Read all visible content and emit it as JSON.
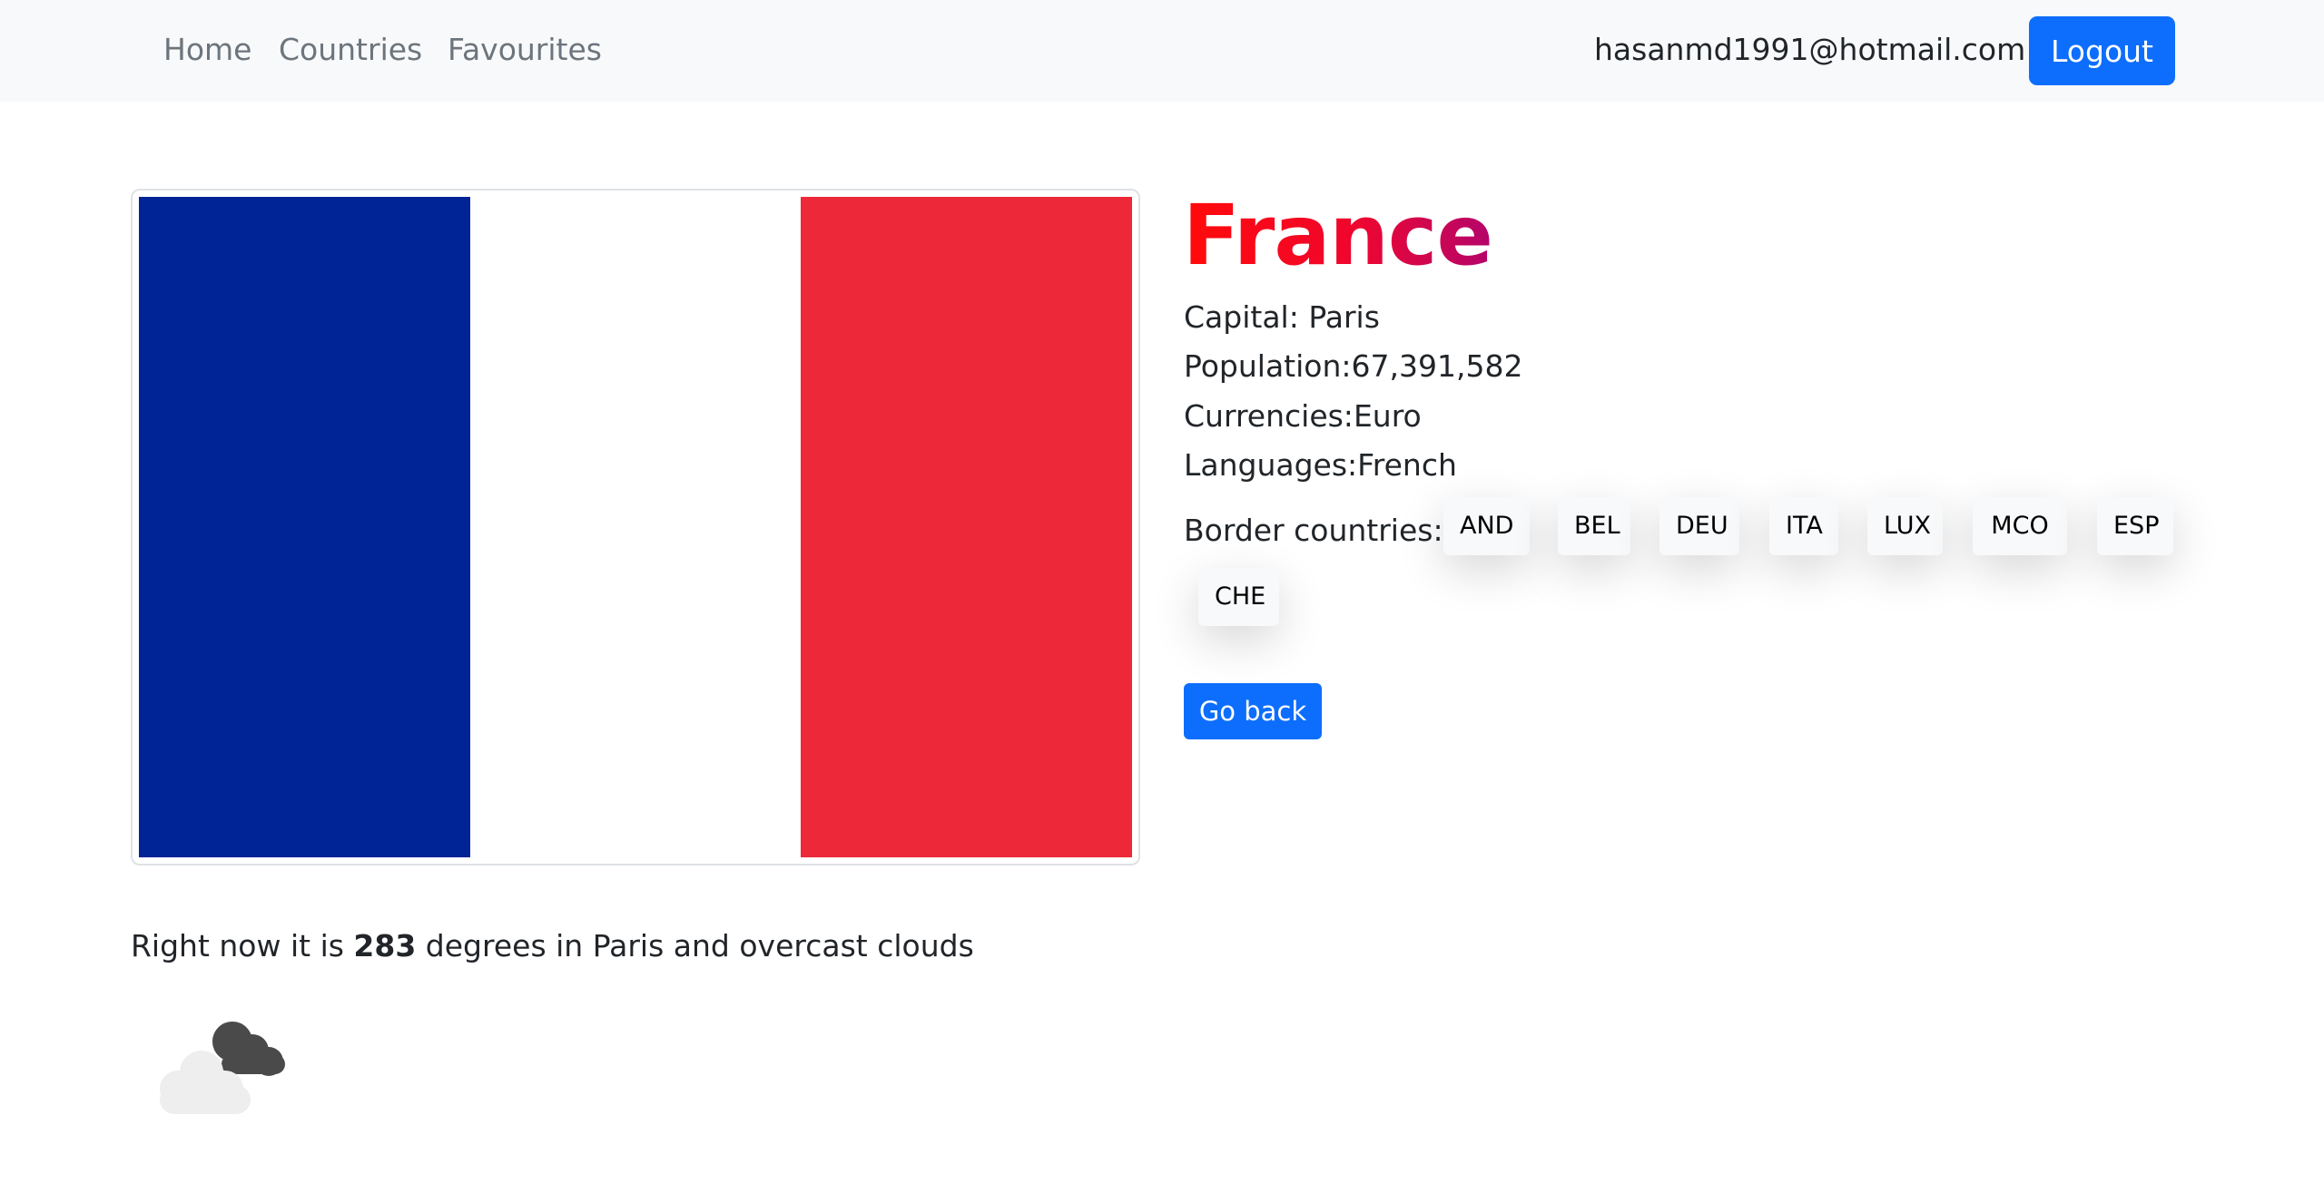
{
  "nav": {
    "home": "Home",
    "countries": "Countries",
    "favourites": "Favourites",
    "user_email": "hasanmd1991@hotmail.com",
    "logout": "Logout"
  },
  "country": {
    "name": "France",
    "capital_label": "Capital: ",
    "capital": "Paris",
    "population_label": "Population:",
    "population": "67,391,582",
    "currencies_label": "Currencies:",
    "currencies": "Euro",
    "languages_label": "Languages:",
    "languages": "French",
    "border_label": "Border countries:",
    "borders": [
      "AND",
      "BEL",
      "DEU",
      "ITA",
      "LUX",
      "MCO",
      "ESP",
      "CHE"
    ],
    "flag_colors": [
      "#002395",
      "#ffffff",
      "#ed2939"
    ]
  },
  "actions": {
    "go_back": "Go back"
  },
  "weather": {
    "prefix": "Right now it is ",
    "temperature": "283",
    "middle": " degrees in ",
    "city": "Paris",
    "connector": " and ",
    "description": "overcast clouds",
    "icon": "overcast-clouds-icon"
  }
}
